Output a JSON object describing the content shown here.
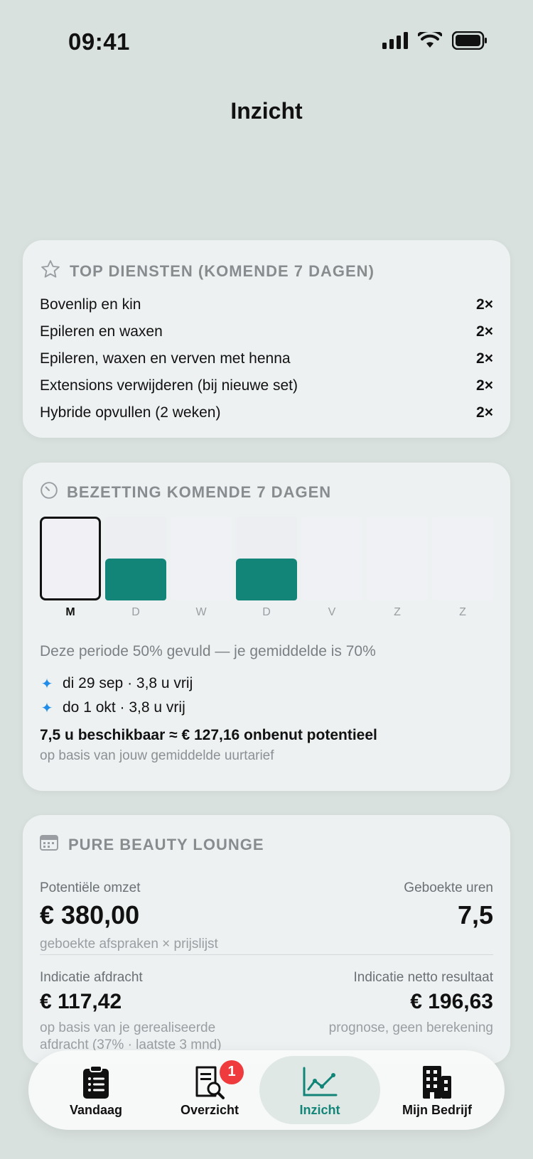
{
  "status_bar": {
    "time": "09:41",
    "icons": [
      "signal-icon",
      "wifi-icon",
      "battery-icon"
    ]
  },
  "page": {
    "title": "Inzicht"
  },
  "top_services": {
    "icon": "star-icon",
    "title": "TOP DIENSTEN (KOMENDE 7 DAGEN)",
    "items": [
      {
        "name": "Bovenlip en kin",
        "count": "2×"
      },
      {
        "name": "Epileren en waxen",
        "count": "2×"
      },
      {
        "name": "Epileren, waxen en verven met henna",
        "count": "2×"
      },
      {
        "name": "Extensions verwijderen (bij nieuwe set)",
        "count": "2×"
      },
      {
        "name": "Hybride opvullen (2 weken)",
        "count": "2×"
      }
    ]
  },
  "occupancy": {
    "icon": "gauge-icon",
    "title": "BEZETTING KOMENDE 7 DAGEN",
    "days": [
      {
        "label": "M",
        "fill": 0,
        "selected": true
      },
      {
        "label": "D",
        "fill": 0.5,
        "selected": false
      },
      {
        "label": "W",
        "fill": 0,
        "selected": false
      },
      {
        "label": "D",
        "fill": 0.5,
        "selected": false
      },
      {
        "label": "V",
        "fill": 0,
        "selected": false
      },
      {
        "label": "Z",
        "fill": 0,
        "selected": false
      },
      {
        "label": "Z",
        "fill": 0,
        "selected": false
      }
    ],
    "summary": "Deze periode 50% gevuld — je gemiddelde is 70%",
    "slots": [
      {
        "text": "di 29 sep · 3,8 u vrij"
      },
      {
        "text": "do 1 okt · 3,8 u vrij"
      }
    ],
    "potential": "7,5 u beschikbaar ≈ € 127,16 onbenut potentieel",
    "potential_note": "op basis van jouw gemiddelde uurtarief",
    "colors": {
      "fill": "#128578",
      "spark": "#1e8ce8"
    }
  },
  "business": {
    "icon": "calendar-icon",
    "title": "PURE BEAUTY LOUNGE",
    "revenue": {
      "label": "Potentiële omzet",
      "value": "€ 380,00",
      "note": "geboekte afspraken × prijslijst"
    },
    "hours": {
      "label": "Geboekte uren",
      "value": "7,5"
    },
    "payout": {
      "label": "Indicatie afdracht",
      "value": "€ 117,42",
      "note_line1": "op basis van je gerealiseerde",
      "note_line2": "afdracht (37% · laatste 3 mnd)"
    },
    "net": {
      "label": "Indicatie netto resultaat",
      "value": "€ 196,63",
      "note": "prognose, geen berekening"
    }
  },
  "tab_bar": {
    "tabs": [
      {
        "label": "Vandaag",
        "icon": "clipboard-icon"
      },
      {
        "label": "Overzicht",
        "icon": "document-search-icon",
        "badge": "1"
      },
      {
        "label": "Inzicht",
        "icon": "chart-line-icon",
        "active": true
      },
      {
        "label": "Mijn Bedrijf",
        "icon": "building-icon"
      }
    ],
    "accent": "#128578",
    "badge_color": "#ef3b3d"
  }
}
